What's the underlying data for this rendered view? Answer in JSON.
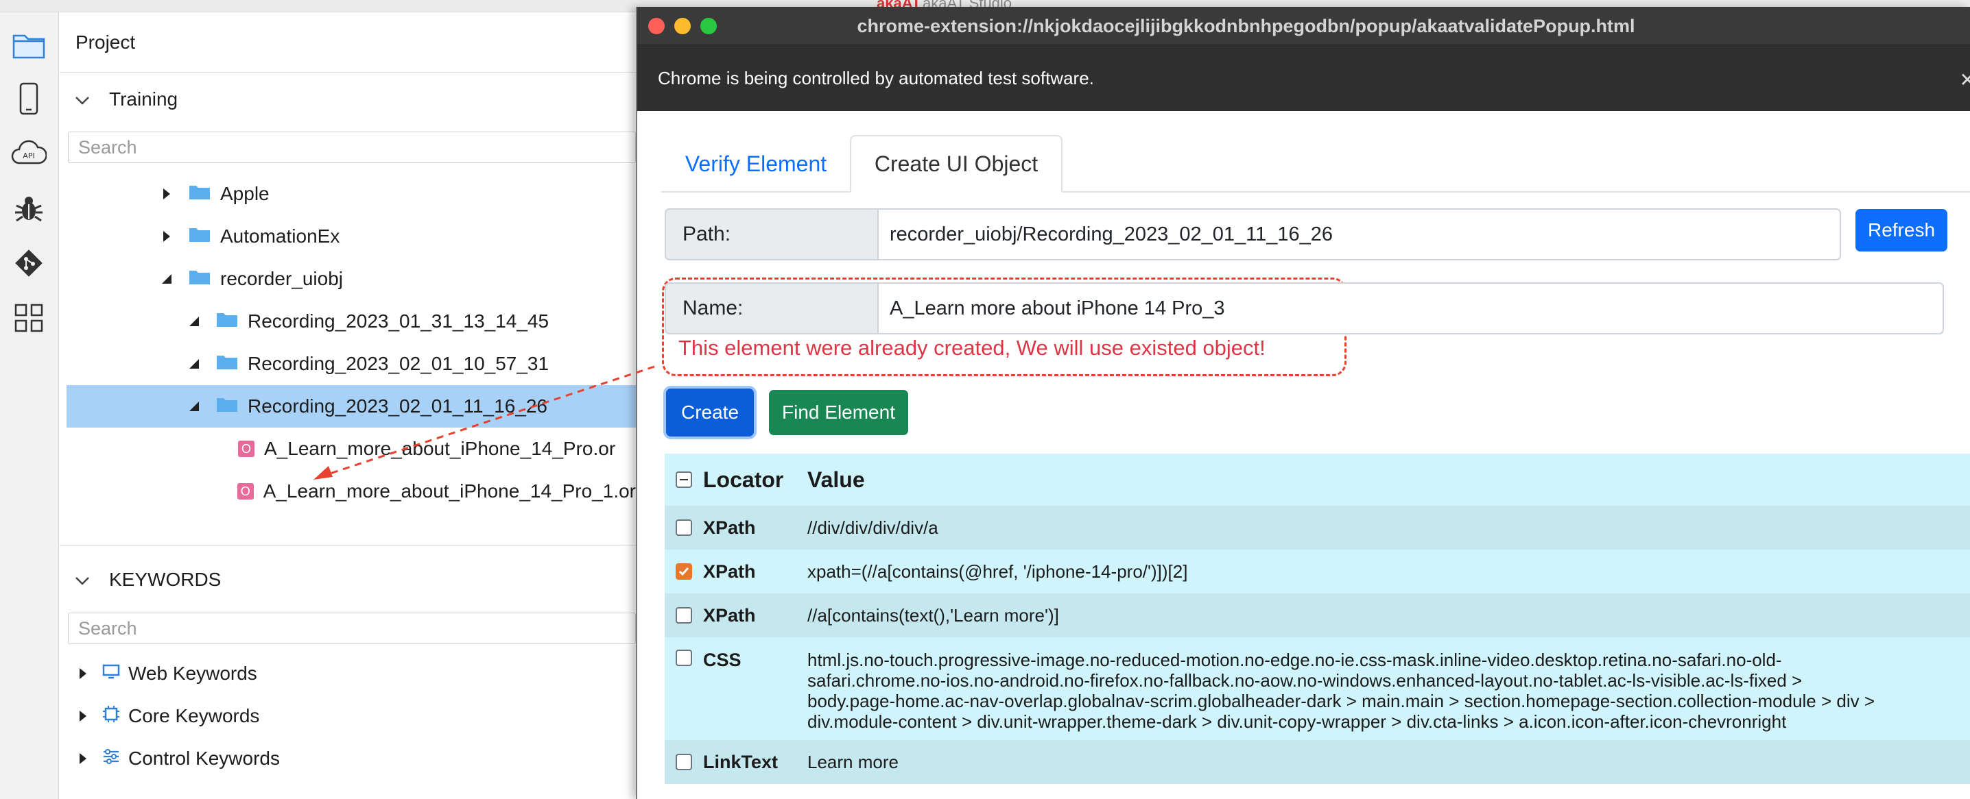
{
  "background_app": {
    "brand": "akaAT",
    "studio": "akaAT Studio"
  },
  "project_panel": {
    "title": "Project",
    "training_header": "Training",
    "search_placeholder": "Search",
    "tree": [
      {
        "label": "Apple",
        "type": "folder",
        "level": 1
      },
      {
        "label": "AutomationEx",
        "type": "folder",
        "level": 1
      },
      {
        "label": "recorder_uiobj",
        "type": "folder",
        "level": 1
      },
      {
        "label": "Recording_2023_01_31_13_14_45",
        "type": "folder",
        "level": 2
      },
      {
        "label": "Recording_2023_02_01_10_57_31",
        "type": "folder",
        "level": 2
      },
      {
        "label": "Recording_2023_02_01_11_16_26",
        "type": "folder",
        "level": 2,
        "selected": true
      },
      {
        "label": "A_Learn_more_about_iPhone_14_Pro.or",
        "type": "object",
        "level": 3
      },
      {
        "label": "A_Learn_more_about_iPhone_14_Pro_1.or",
        "type": "object",
        "level": 3
      }
    ],
    "keywords_header": "KEYWORDS",
    "keywords_search_placeholder": "Search",
    "keywords": [
      {
        "label": "Web Keywords",
        "icon": "monitor-icon"
      },
      {
        "label": "Core Keywords",
        "icon": "chip-icon"
      },
      {
        "label": "Control Keywords",
        "icon": "sliders-icon"
      }
    ]
  },
  "popup": {
    "window_title": "chrome-extension://nkjokdaocejlijibgkkodnbnhpegodbn/popup/akaatvalidatePopup.html",
    "infobar_text": "Chrome is being controlled by automated test software.",
    "tabs": [
      "Verify Element",
      "Create UI Object"
    ],
    "active_tab": "Create UI Object",
    "path_label": "Path:",
    "path_value": "recorder_uiobj/Recording_2023_02_01_11_16_26",
    "refresh_label": "Refresh",
    "name_label": "Name:",
    "name_value": "A_Learn more about iPhone 14 Pro_3",
    "error_text": "This element were already created, We will use existed object!",
    "create_label": "Create",
    "find_label": "Find Element",
    "table": {
      "headers": [
        "Locator",
        "Value"
      ],
      "rows": [
        {
          "locator": "XPath",
          "value": "//div/div/div/div/a",
          "checked": false
        },
        {
          "locator": "XPath",
          "value": "xpath=(//a[contains(@href, '/iphone-14-pro/')])[2]",
          "checked": true
        },
        {
          "locator": "XPath",
          "value": "//a[contains(text(),'Learn more')]",
          "checked": false
        },
        {
          "locator": "CSS",
          "value_lines": [
            "html.js.no-touch.progressive-image.no-reduced-motion.no-edge.no-ie.css-mask.inline-video.desktop.retina.no-safari.no-old-",
            "safari.chrome.no-ios.no-android.no-firefox.no-fallback.no-aow.no-windows.enhanced-layout.no-tablet.ac-ls-visible.ac-ls-fixed >",
            "body.page-home.ac-nav-overlap.globalnav-scrim.globalheader-dark > main.main > section.homepage-section.collection-module > div >",
            "div.module-content > div.unit-wrapper.theme-dark > div.unit-copy-wrapper > div.cta-links > a.icon.icon-after.icon-chevronright"
          ],
          "checked": false
        },
        {
          "locator": "LinkText",
          "value": "Learn more",
          "checked": false
        }
      ]
    }
  },
  "colors": {
    "accent_blue": "#0d6efd",
    "success_green": "#198754",
    "error_red": "#dc3545",
    "selected_row": "#a8d1f7",
    "table_bg": "#cff4fc"
  }
}
